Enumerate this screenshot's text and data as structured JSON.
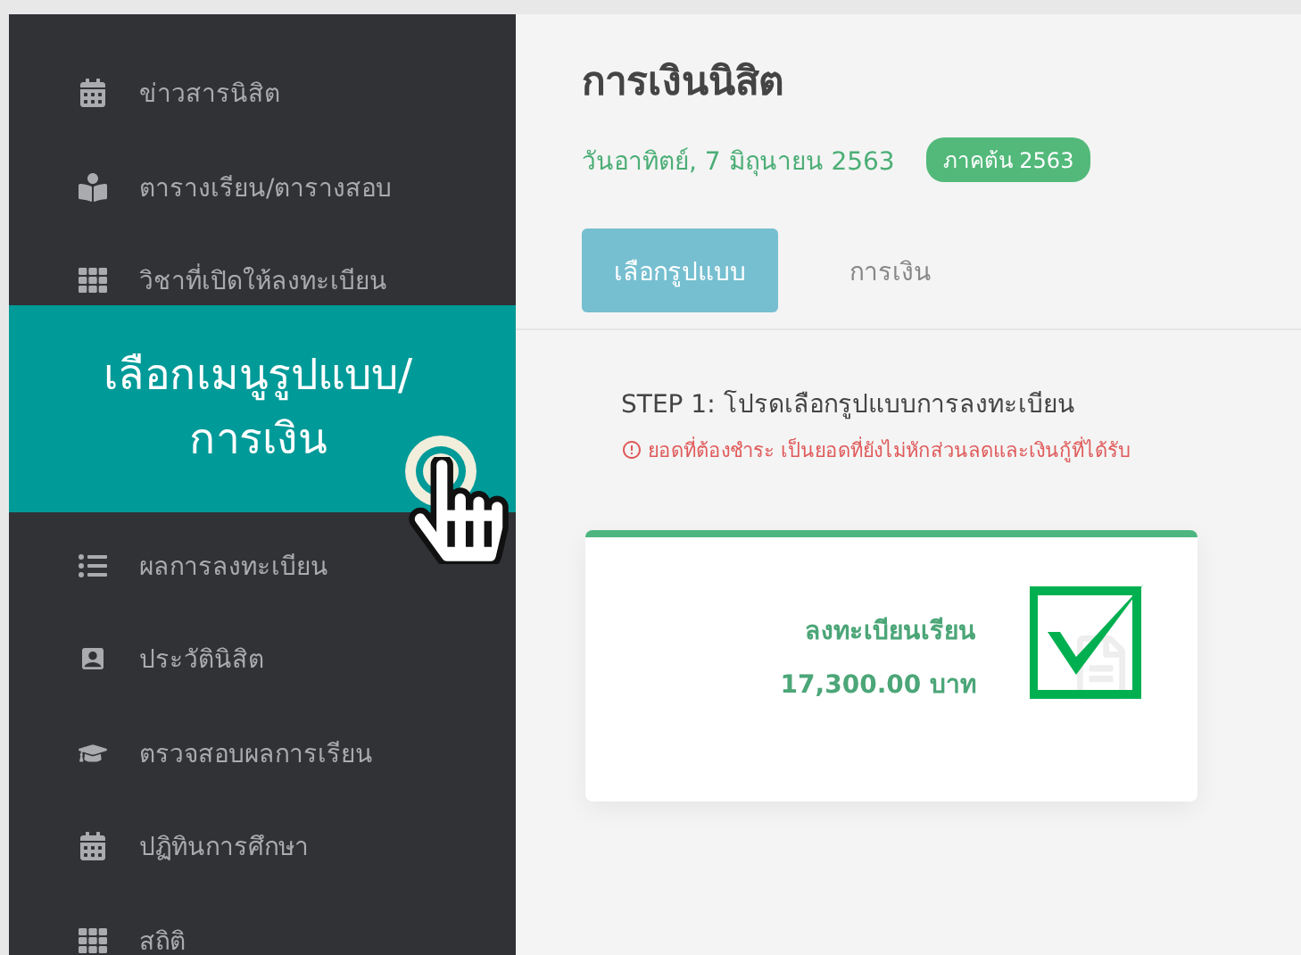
{
  "sidebar": {
    "items": [
      {
        "label": "ข่าวสารนิสิต"
      },
      {
        "label": "ตารางเรียน/ตารางสอบ"
      },
      {
        "label": "วิชาที่เปิดให้ลงทะเบียน"
      },
      {
        "label": "ผลการลงทะเบียน"
      },
      {
        "label": "ประวัตินิสิต"
      },
      {
        "label": "ตรวจสอบผลการเรียน"
      },
      {
        "label": "ปฏิทินการศึกษา"
      },
      {
        "label": "สถิติ"
      }
    ]
  },
  "callout": {
    "lines": [
      "เลือกเมนูรูปแบบ/",
      "การเงิน"
    ]
  },
  "header": {
    "title": "การเงินนิสิต",
    "date": "วันอาทิตย์, 7 มิถุนายน 2563",
    "term_badge": "ภาคต้น 2563"
  },
  "tabs": [
    {
      "label": "เลือกรูปแบบ",
      "selected": true
    },
    {
      "label": "การเงิน",
      "selected": false
    }
  ],
  "step": {
    "title": "STEP 1: โปรดเลือกรูปแบบการลงทะเบียน",
    "warning": "ยอดที่ต้องชำระ เป็นยอดที่ยังไม่หักส่วนลดและเงินกู้ที่ได้รับ"
  },
  "option_card": {
    "name": "ลงทะเบียนเรียน",
    "amount": "17,300.00 บาท",
    "checked": true
  }
}
